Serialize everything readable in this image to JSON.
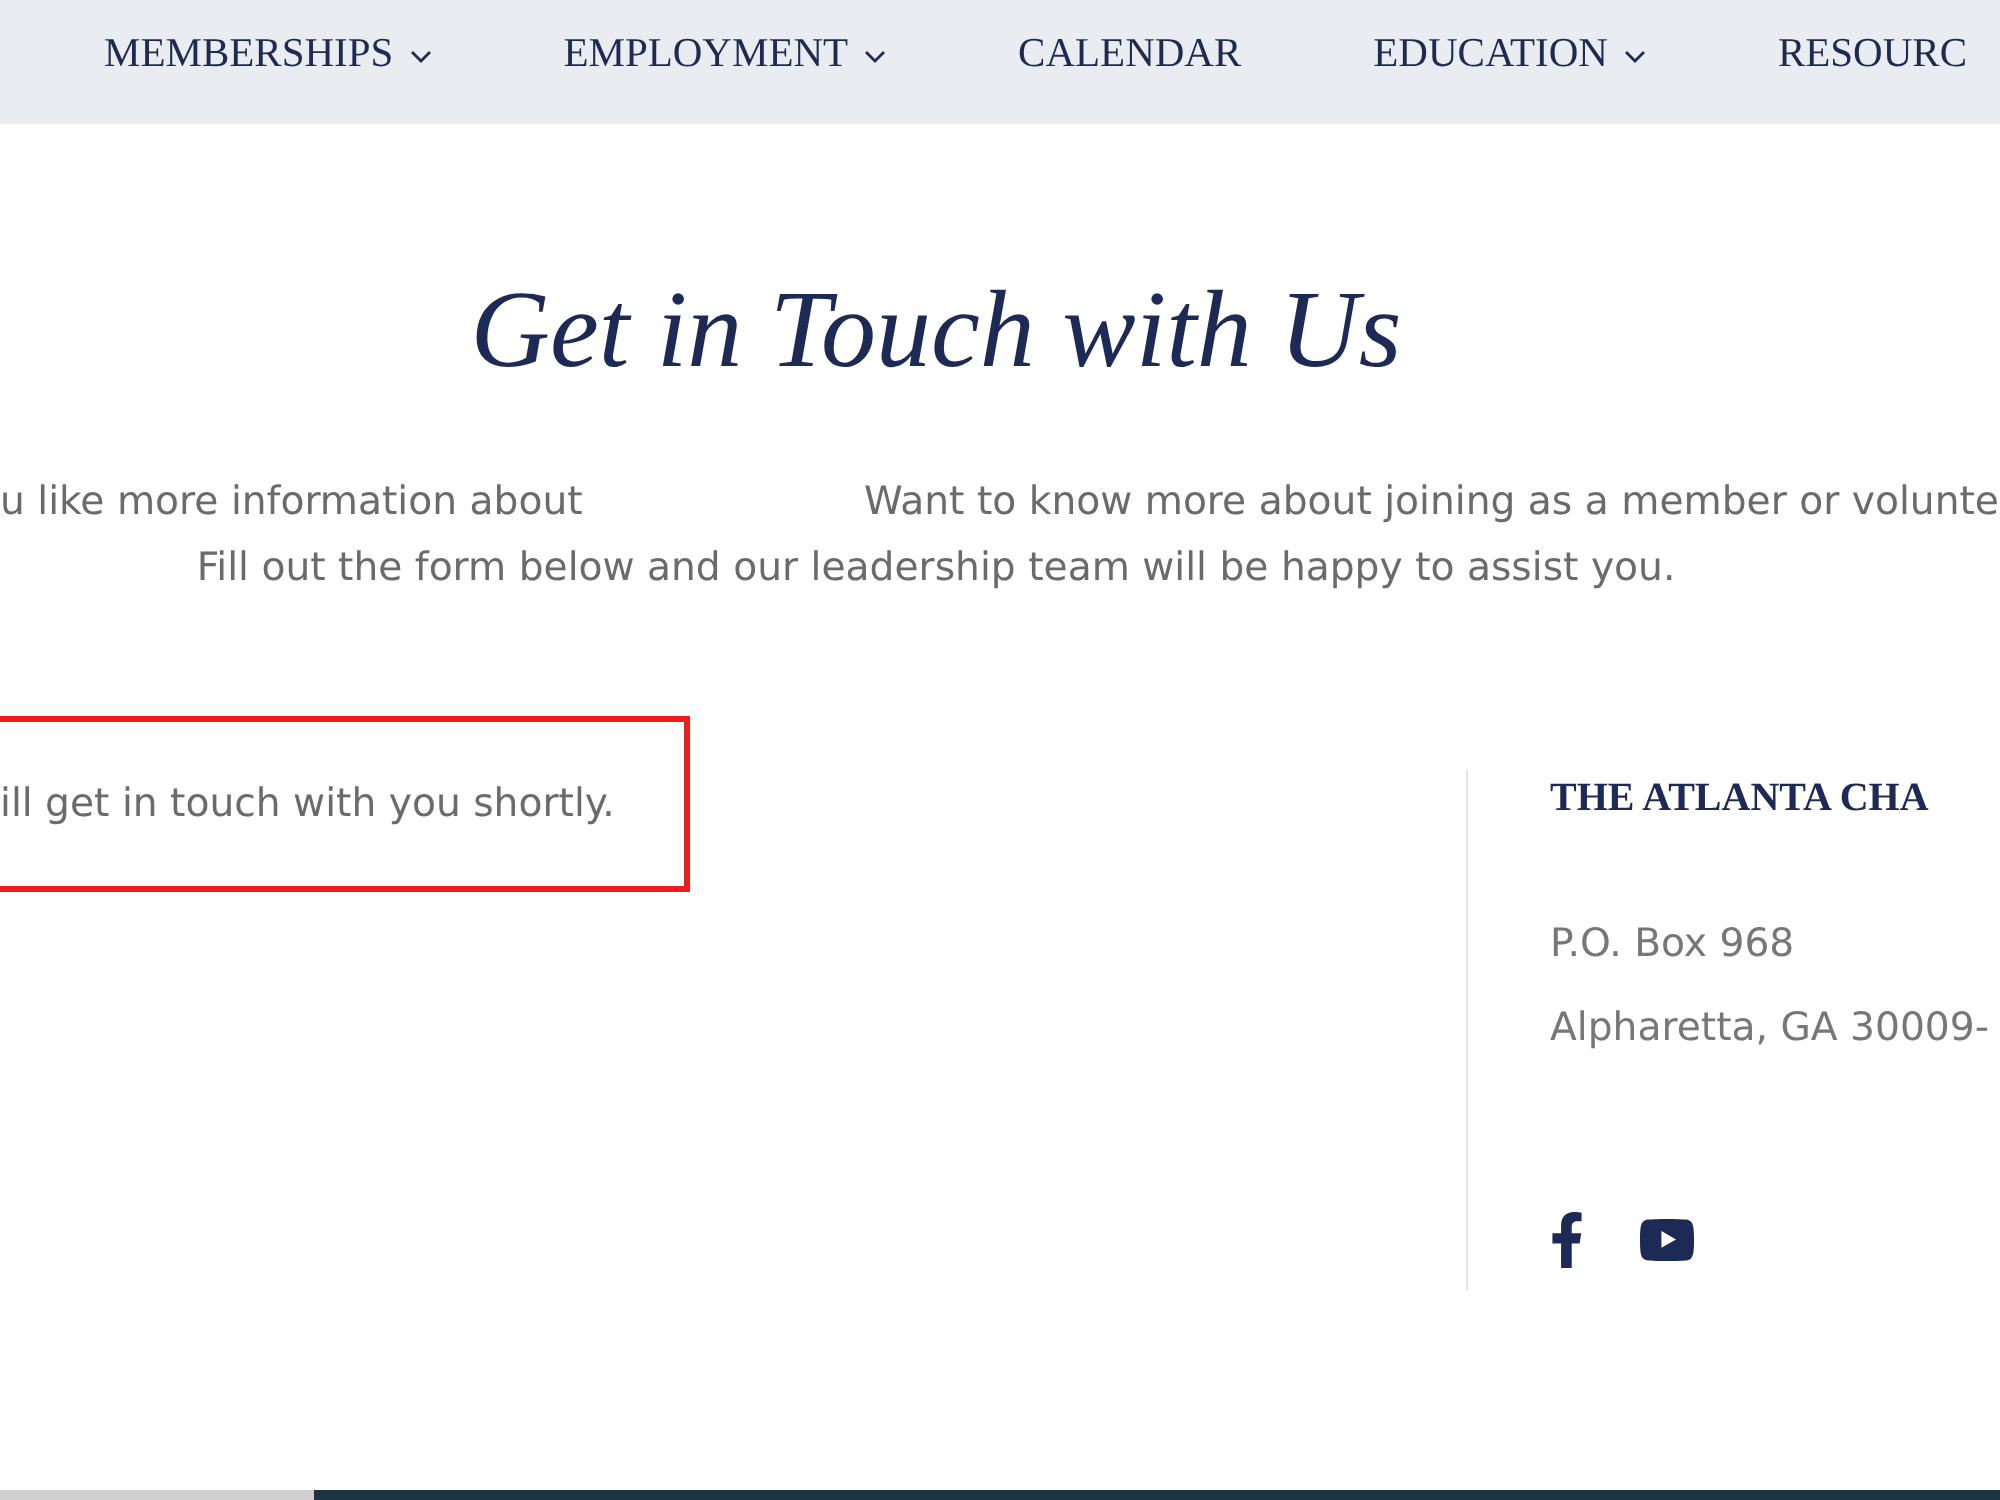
{
  "nav": {
    "items": [
      {
        "label": "MEMBERSHIPS",
        "has_dropdown": true
      },
      {
        "label": "EMPLOYMENT",
        "has_dropdown": true
      },
      {
        "label": "CALENDAR",
        "has_dropdown": false
      },
      {
        "label": "EDUCATION",
        "has_dropdown": true
      },
      {
        "label": "RESOURC",
        "has_dropdown": false
      }
    ]
  },
  "heading": "Get in Touch with Us",
  "intro": {
    "line_1_parts": [
      "u like more information about",
      "Want to know more about joining as a member or volunte"
    ],
    "line_2": "Fill out the form below and our leadership team will be happy to assist you."
  },
  "message": {
    "text": "ill get in touch with you shortly."
  },
  "contact": {
    "title": "THE ATLANTA CHA",
    "address_lines": [
      "P.O. Box 968",
      "Alpharetta, GA 30009-"
    ],
    "social": [
      {
        "kind": "facebook"
      },
      {
        "kind": "youtube"
      }
    ]
  }
}
